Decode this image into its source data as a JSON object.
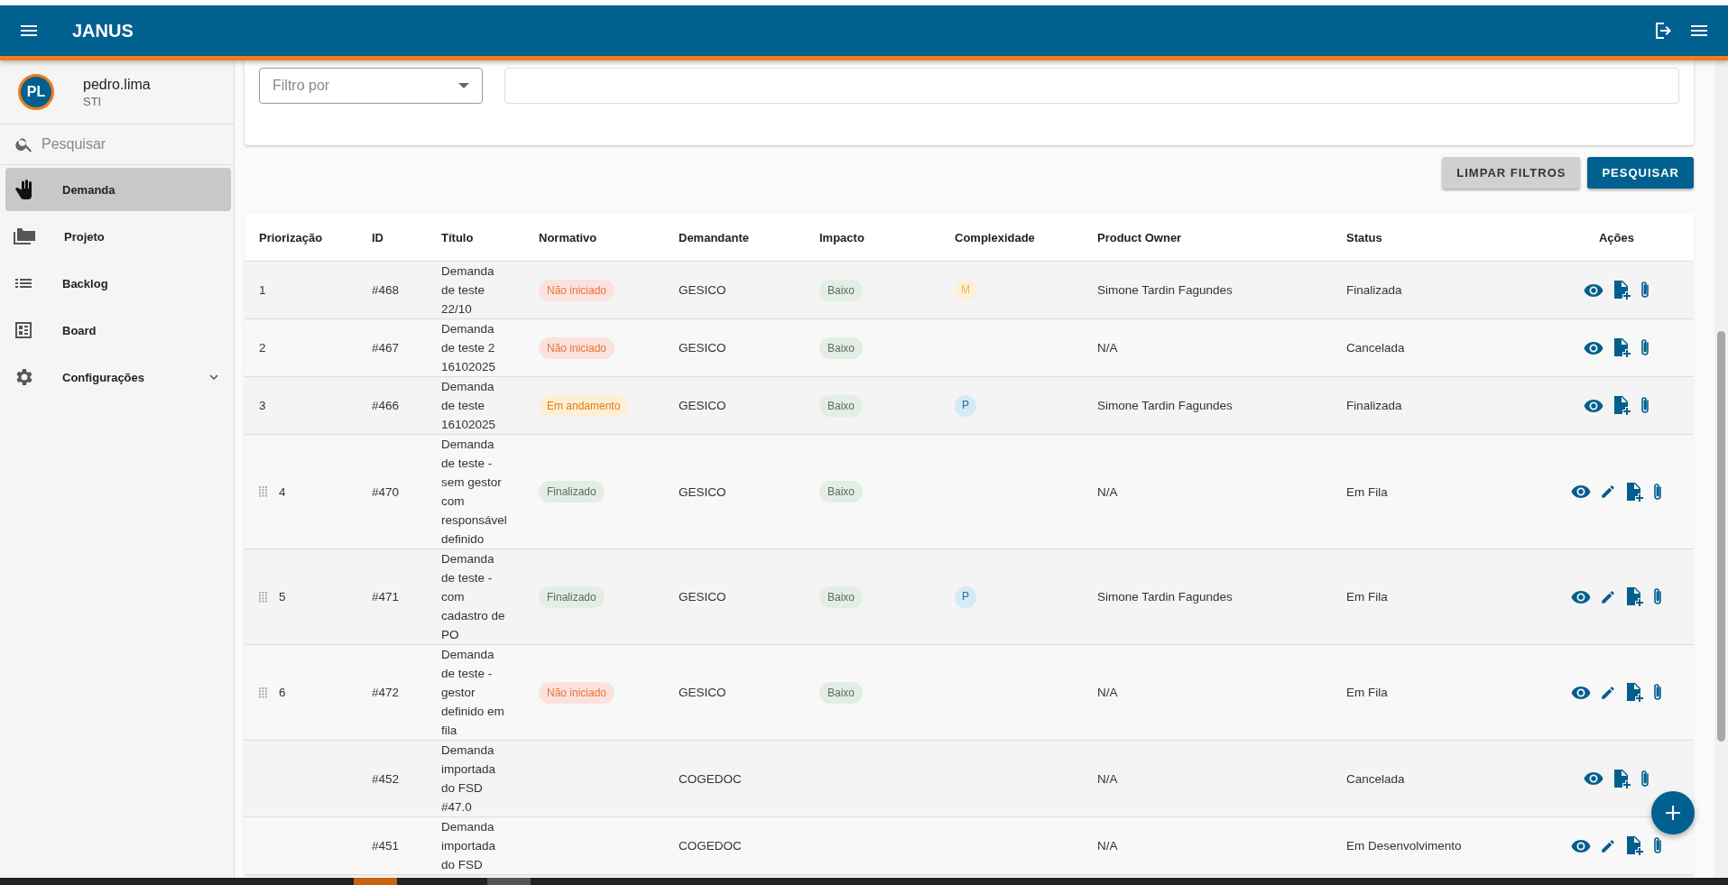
{
  "header": {
    "title": "JANUS"
  },
  "user": {
    "initials": "PL",
    "name": "pedro.lima",
    "unit": "STI"
  },
  "sidebar": {
    "search": {
      "placeholder": "Pesquisar"
    },
    "items": [
      {
        "label": "Demanda",
        "selected": true,
        "submenu": false
      },
      {
        "label": "Projeto",
        "selected": false,
        "submenu": false
      },
      {
        "label": "Backlog",
        "selected": false,
        "submenu": false
      },
      {
        "label": "Board",
        "selected": false,
        "submenu": false
      },
      {
        "label": "Configurações",
        "selected": false,
        "submenu": true
      }
    ]
  },
  "filter": {
    "select": {
      "placeholder": "Filtro por"
    }
  },
  "buttons": [
    {
      "label": "LIMPAR FILTROS",
      "kind": "secondary"
    },
    {
      "label": "PESQUISAR",
      "kind": "primary"
    }
  ],
  "table": {
    "columns": [
      "Priorização",
      "ID",
      "Título",
      "Normativo",
      "Demandante",
      "Impacto",
      "Complexidade",
      "Product Owner",
      "Status",
      "Ações"
    ],
    "rows": [
      {
        "priority": "1",
        "draggable": false,
        "id": "#468",
        "title": "Demanda de teste 22/10",
        "normativo": {
          "label": "Não iniciado",
          "kind": "pending"
        },
        "demandante": "GESICO",
        "impacto": {
          "label": "Baixo",
          "kind": "low"
        },
        "complexidade": {
          "label": "M",
          "kind": "medium"
        },
        "product_owner": "Simone Tardin Fagundes",
        "status": "Finalizada",
        "editable": false
      },
      {
        "priority": "2",
        "draggable": false,
        "id": "#467",
        "title": "Demanda de teste 2 16102025",
        "normativo": {
          "label": "Não iniciado",
          "kind": "pending"
        },
        "demandante": "GESICO",
        "impacto": {
          "label": "Baixo",
          "kind": "low"
        },
        "product_owner": "N/A",
        "status": "Cancelada",
        "editable": false
      },
      {
        "priority": "3",
        "draggable": false,
        "id": "#466",
        "title": "Demanda de teste 16102025",
        "normativo": {
          "label": "Em andamento",
          "kind": "progress"
        },
        "demandante": "GESICO",
        "impacto": {
          "label": "Baixo",
          "kind": "low"
        },
        "complexidade": {
          "label": "P",
          "kind": "small"
        },
        "product_owner": "Simone Tardin Fagundes",
        "status": "Finalizada",
        "editable": false
      },
      {
        "priority": "4",
        "draggable": true,
        "id": "#470",
        "title": "Demanda de teste - sem gestor com responsável definido",
        "normativo": {
          "label": "Finalizado",
          "kind": "done"
        },
        "demandante": "GESICO",
        "impacto": {
          "label": "Baixo",
          "kind": "low"
        },
        "product_owner": "N/A",
        "status": "Em Fila",
        "editable": true
      },
      {
        "priority": "5",
        "draggable": true,
        "id": "#471",
        "title": "Demanda de teste - com cadastro de PO",
        "normativo": {
          "label": "Finalizado",
          "kind": "done"
        },
        "demandante": "GESICO",
        "impacto": {
          "label": "Baixo",
          "kind": "low"
        },
        "complexidade": {
          "label": "P",
          "kind": "small"
        },
        "product_owner": "Simone Tardin Fagundes",
        "status": "Em Fila",
        "editable": true
      },
      {
        "priority": "6",
        "draggable": true,
        "id": "#472",
        "title": "Demanda de teste - gestor definido em fila",
        "normativo": {
          "label": "Não iniciado",
          "kind": "pending"
        },
        "demandante": "GESICO",
        "impacto": {
          "label": "Baixo",
          "kind": "low"
        },
        "product_owner": "N/A",
        "status": "Em Fila",
        "editable": true
      },
      {
        "draggable": false,
        "id": "#452",
        "title": "Demanda importada do FSD #47.0",
        "demandante": "COGEDOC",
        "product_owner": "N/A",
        "status": "Cancelada",
        "editable": false
      },
      {
        "draggable": false,
        "id": "#451",
        "title": "Demanda importada do FSD",
        "demandante": "COGEDOC",
        "product_owner": "N/A",
        "status": "Em Desenvolvimento",
        "editable": true
      }
    ]
  }
}
